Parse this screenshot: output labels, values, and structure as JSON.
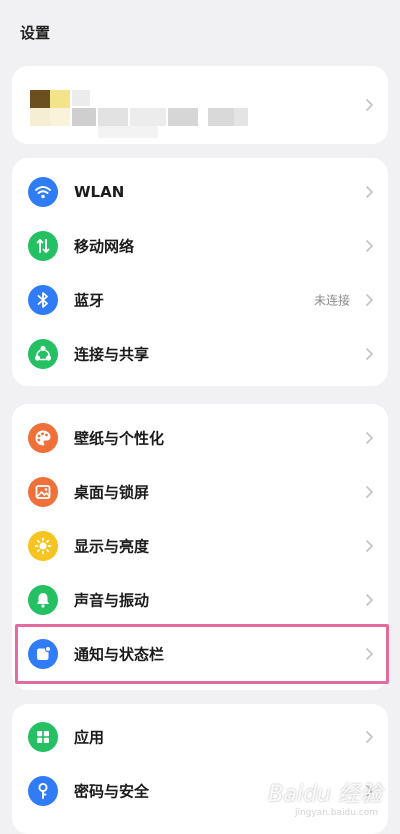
{
  "header": {
    "title": "设置"
  },
  "account": {},
  "network": {
    "items": [
      {
        "label": "WLAN",
        "value": "",
        "icon": "wifi-icon",
        "color": "#2f7cf6"
      },
      {
        "label": "移动网络",
        "value": "",
        "icon": "mobile-data-icon",
        "color": "#25c063"
      },
      {
        "label": "蓝牙",
        "value": "未连接",
        "icon": "bluetooth-icon",
        "color": "#2f7cf6"
      },
      {
        "label": "连接与共享",
        "value": "",
        "icon": "share-connection-icon",
        "color": "#25c063"
      }
    ]
  },
  "display": {
    "items": [
      {
        "label": "壁纸与个性化",
        "icon": "palette-icon",
        "color": "#f0703a"
      },
      {
        "label": "桌面与锁屏",
        "icon": "image-icon",
        "color": "#f0703a"
      },
      {
        "label": "显示与亮度",
        "icon": "sun-icon",
        "color": "#f6c420"
      },
      {
        "label": "声音与振动",
        "icon": "bell-icon",
        "color": "#25c063"
      },
      {
        "label": "通知与状态栏",
        "icon": "notification-icon",
        "color": "#2f7cf6"
      }
    ]
  },
  "system": {
    "items": [
      {
        "label": "应用",
        "icon": "apps-grid-icon",
        "color": "#25c063"
      },
      {
        "label": "密码与安全",
        "icon": "key-icon",
        "color": "#2f7cf6"
      }
    ]
  },
  "watermark": {
    "text": "Baidu 经验",
    "sub": "jingyan.baidu.com"
  }
}
